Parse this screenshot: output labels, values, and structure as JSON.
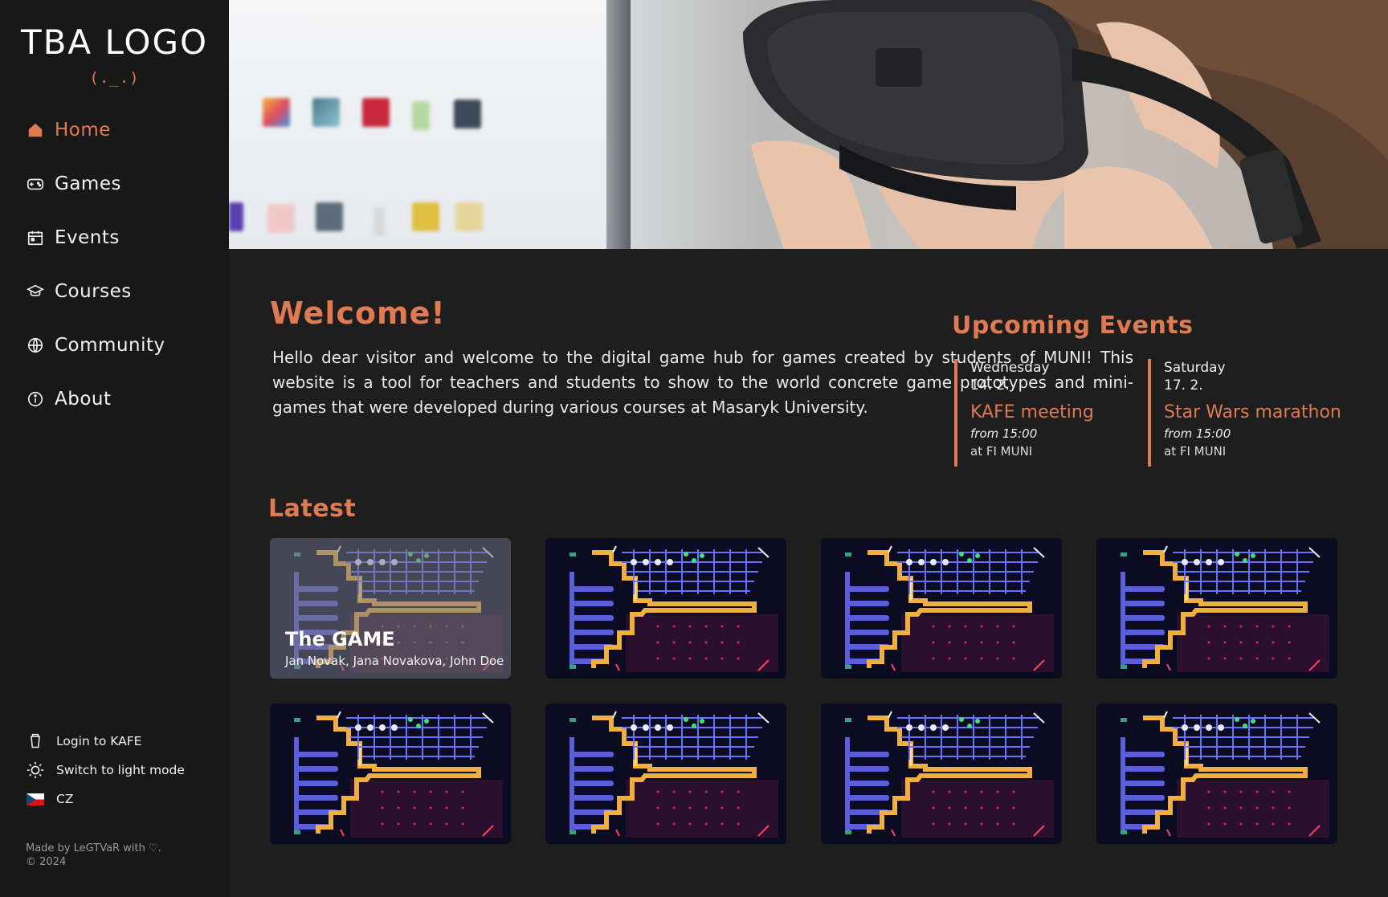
{
  "brand": {
    "logo_text": "TBA LOGO",
    "logo_face": "(._.)",
    "accent": "#e07a52"
  },
  "nav": {
    "items": [
      {
        "label": "Home",
        "icon": "home-icon",
        "active": true
      },
      {
        "label": "Games",
        "icon": "gamepad-icon"
      },
      {
        "label": "Events",
        "icon": "calendar-icon"
      },
      {
        "label": "Courses",
        "icon": "graduation-cap-icon"
      },
      {
        "label": "Community",
        "icon": "globe-icon"
      },
      {
        "label": "About",
        "icon": "info-icon"
      }
    ]
  },
  "sidebar_bottom": {
    "login": "Login to KAFE",
    "theme": "Switch to light mode",
    "language": "CZ"
  },
  "footer": {
    "line1": "Made by LeGTVaR with ♡.",
    "line2": "© 2024"
  },
  "welcome": {
    "title": "Welcome!",
    "text": "Hello dear visitor and welcome to the digital game hub for games created by students of MUNI! This website is a tool for teachers and students to show to the world concrete game prototypes and mini-games that were developed during various courses at Masaryk University."
  },
  "events": {
    "title": "Upcoming Events",
    "items": [
      {
        "weekday": "Wednesday",
        "date": "14. 2.",
        "name": "KAFE meeting",
        "time": "from 15:00",
        "place": "at FI MUNI"
      },
      {
        "weekday": "Saturday",
        "date": "17. 2.",
        "name": "Star Wars marathon",
        "time": "from 15:00",
        "place": "at FI MUNI"
      }
    ]
  },
  "latest": {
    "title": "Latest",
    "featured": {
      "title": "The GAME",
      "authors": "Jan Novak, Jana Novakova, John Doe"
    }
  }
}
